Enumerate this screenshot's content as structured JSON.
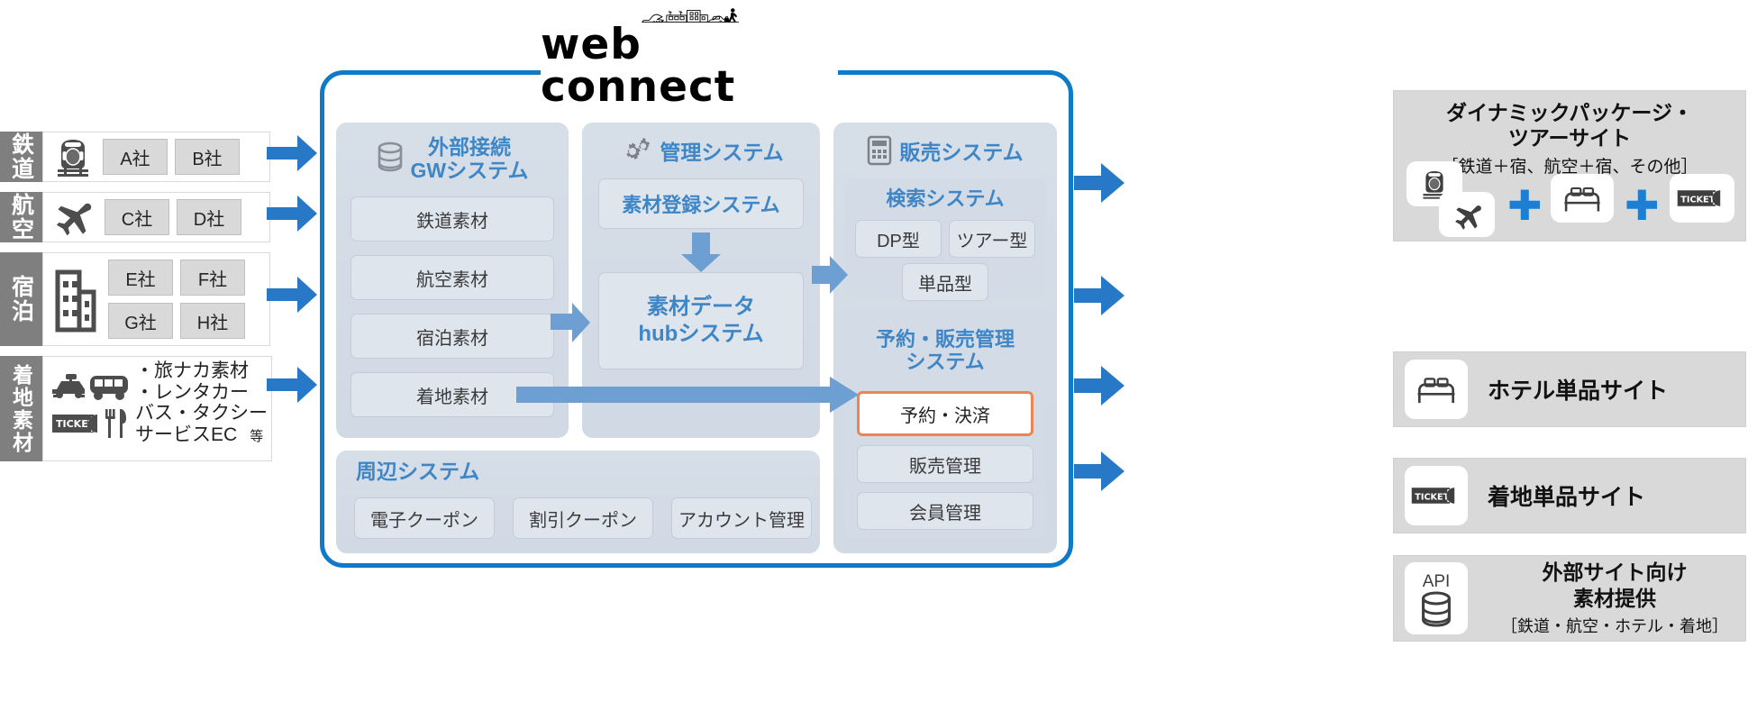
{
  "logo": {
    "word": "web connect",
    "alt": "city-skyline-illustration"
  },
  "sources": [
    {
      "category": "鉄道",
      "icon": "train-icon",
      "chips": [
        "A社",
        "B社"
      ]
    },
    {
      "category": "航空",
      "icon": "airplane-icon",
      "chips": [
        "C社",
        "D社"
      ]
    },
    {
      "category": "宿泊",
      "icon": "building-icon",
      "chips": [
        "E社",
        "F社",
        "G社",
        "H社"
      ]
    },
    {
      "category": "着地素材",
      "icon": "taxi-bus-ticket-food-icon",
      "list": [
        "・旅ナカ素材",
        "・レンタカー",
        "バス・タクシー",
        "サービスEC"
      ],
      "etc": "等"
    }
  ],
  "gateway": {
    "icon": "database-icon",
    "title_line1": "外部接続",
    "title_line2": "GWシステム",
    "items": [
      "鉄道素材",
      "航空素材",
      "宿泊素材",
      "着地素材"
    ]
  },
  "management": {
    "icon": "gears-icon",
    "title": "管理システム",
    "register_label": "素材登録システム",
    "hub_line1": "素材データ",
    "hub_line2": "hubシステム"
  },
  "sales": {
    "icon": "calculator-icon",
    "title": "販売システム",
    "search": {
      "title": "検索システム",
      "items": [
        "DP型",
        "ツアー型",
        "単品型"
      ]
    },
    "booking": {
      "title_line1": "予約・販売管理",
      "title_line2": "システム",
      "highlight": "予約・決済",
      "items": [
        "販売管理",
        "会員管理"
      ]
    }
  },
  "peripheral": {
    "title": "周辺システム",
    "items": [
      "電子クーポン",
      "割引クーポン",
      "アカウント管理"
    ]
  },
  "outputs": [
    {
      "title_line1": "ダイナミックパッケージ・",
      "title_line2": "ツアーサイト",
      "subtitle": "［鉄道＋宿、航空＋宿、その他］",
      "icons": [
        "train-icon",
        "airplane-icon",
        "bed-icon",
        "ticket-icon"
      ],
      "plus": "✚"
    },
    {
      "title": "ホテル単品サイト",
      "icon": "bed-icon"
    },
    {
      "title": "着地単品サイト",
      "icon": "ticket-icon"
    },
    {
      "title_line1": "外部サイト向け",
      "title_line2": "素材提供",
      "subtitle": "［鉄道・航空・ホテル・着地］",
      "icon": "api-database-icon",
      "icon_label": "API"
    }
  ],
  "colors": {
    "brand_blue": "#0f7ac7",
    "arrow_blue": "#2878c8",
    "panel_blue_text": "#3f86c6",
    "highlight_orange": "#ed8455",
    "tab_gray": "#7f7f7f",
    "panel_bg": "#d6dee8"
  }
}
